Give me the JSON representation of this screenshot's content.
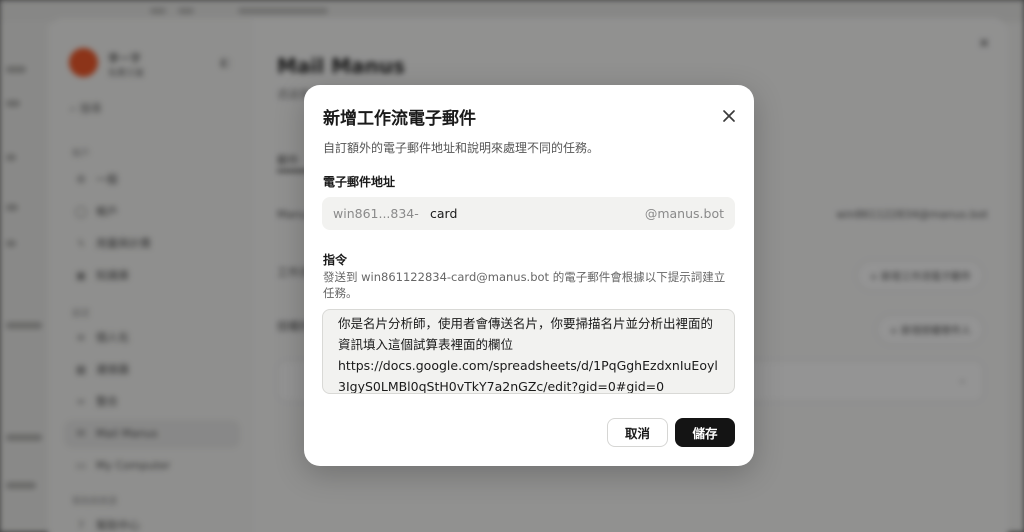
{
  "background": {
    "user_name": "李一字",
    "user_sub": "免費方案",
    "search_label": "搜尋",
    "section_account": "帳戶",
    "nav_account": [
      "一般",
      "帳戶",
      "用量與計費",
      "知識庫"
    ],
    "section_settings": "設定",
    "nav_settings": [
      "個人化",
      "連接器",
      "整合",
      "Mail Manus",
      "My Computer"
    ],
    "section_help": "幫助與資源",
    "nav_help": [
      "幫助中心"
    ],
    "page_title": "Mail Manus",
    "page_subtitle": "透過電子郵件將任務傳送給 Manus",
    "row_labels": [
      "郵件",
      "Manus 電子郵件",
      "工作流電子郵件",
      "授權的寄件人"
    ],
    "bg_email": "win861122834@manus.bot",
    "action_workflow": "+ 新增工作流電子郵件",
    "action_sender": "+ 新增授權寄件人",
    "accent_color": "#f15a2b"
  },
  "dialog": {
    "title": "新增工作流電子郵件",
    "description": "自訂額外的電子郵件地址和說明來處理不同的任務。",
    "email_label": "電子郵件地址",
    "email_prefix": "win861...834-",
    "email_value": "card",
    "email_suffix": "@manus.bot",
    "instruction_label": "指令",
    "instruction_description": "發送到 win861122834-card@manus.bot 的電子郵件會根據以下提示詞建立任務。",
    "instruction_value": "你是名片分析師，使用者會傳送名片，你要掃描名片並分析出裡面的資訊填入這個試算表裡面的欄位\nhttps://docs.google.com/spreadsheets/d/1PqGghEzdxnIuEoyl3IgyS0LMBl0qStH0vTkY7a2nGZc/edit?gid=0#gid=0",
    "cancel_label": "取消",
    "save_label": "儲存",
    "close_icon": "close-icon"
  }
}
